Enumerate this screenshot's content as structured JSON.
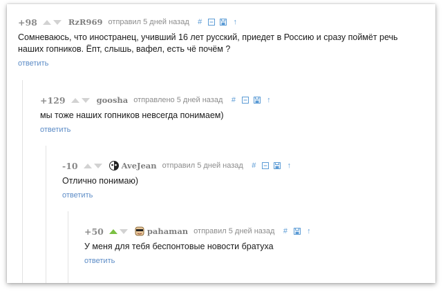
{
  "comments": [
    {
      "rating": "+98",
      "author": "RzR969",
      "posted": "отправил 5 дней назад",
      "text_lines": [
        "Сомневаюсь, что иностранец, учивший 16 лет русский, приедет в Россию и сразу поймёт речь",
        "наших гопников. Ёпт, слышь, вафел, есть чё почём ?"
      ],
      "reply": "ответить"
    },
    {
      "rating": "+129",
      "author": "goosha",
      "posted": "отправлено 5 дней назад",
      "text_lines": [
        "мы тоже наших гопников невсегда понимаем)"
      ],
      "reply": "ответить"
    },
    {
      "rating": "-10",
      "author": "AveJean",
      "posted": "отправил 5 дней назад",
      "text_lines": [
        "Отлично понимаю)"
      ],
      "reply": "ответить"
    },
    {
      "rating": "+50",
      "author": "pahaman",
      "posted": "отправил 5 дней назад",
      "text_lines": [
        "У меня для тебя беспонтовые новости братуха"
      ],
      "reply": "ответить"
    }
  ],
  "tool_icons": {
    "link": "#",
    "collapse": "minus-square-icon",
    "save": "save-icon",
    "parent": "↑"
  },
  "colors": {
    "upvote_active": "#7bc043",
    "link_blue": "#5b8bc6"
  }
}
